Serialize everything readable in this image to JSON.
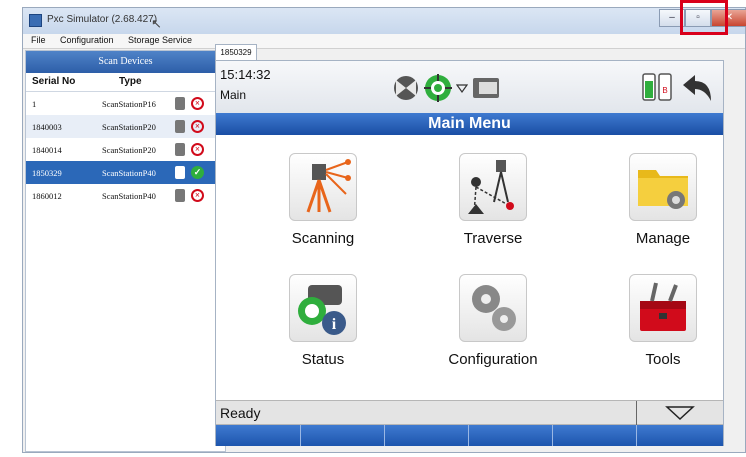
{
  "window": {
    "title": "Pxc Simulator (2.68.427)",
    "min_label": "–",
    "max_label": "▫",
    "close_label": "✕"
  },
  "menu": [
    "File",
    "Configuration",
    "Storage Service"
  ],
  "scan_devices": {
    "header": "Scan Devices",
    "columns": [
      "Serial No",
      "Type"
    ],
    "rows": [
      {
        "serial": "1",
        "type": "ScanStationP16",
        "status": "disconnected"
      },
      {
        "serial": "1840003",
        "type": "ScanStationP20",
        "status": "disconnected"
      },
      {
        "serial": "1840014",
        "type": "ScanStationP20",
        "status": "disconnected"
      },
      {
        "serial": "1850329",
        "type": "ScanStationP40",
        "status": "connected",
        "selected": true
      },
      {
        "serial": "1860012",
        "type": "ScanStationP40",
        "status": "disconnected"
      }
    ]
  },
  "instrument_tab": "1850329",
  "screen": {
    "time": "15:14:32",
    "mode": "Main",
    "title": "Main Menu",
    "tiles": [
      "Scanning",
      "Traverse",
      "Manage",
      "Status",
      "Configuration",
      "Tools"
    ],
    "status": "Ready"
  },
  "colors": {
    "accent": "#2b68b8",
    "highlight": "#d9001b",
    "error": "#d10b1b",
    "ok": "#2fae3d"
  }
}
